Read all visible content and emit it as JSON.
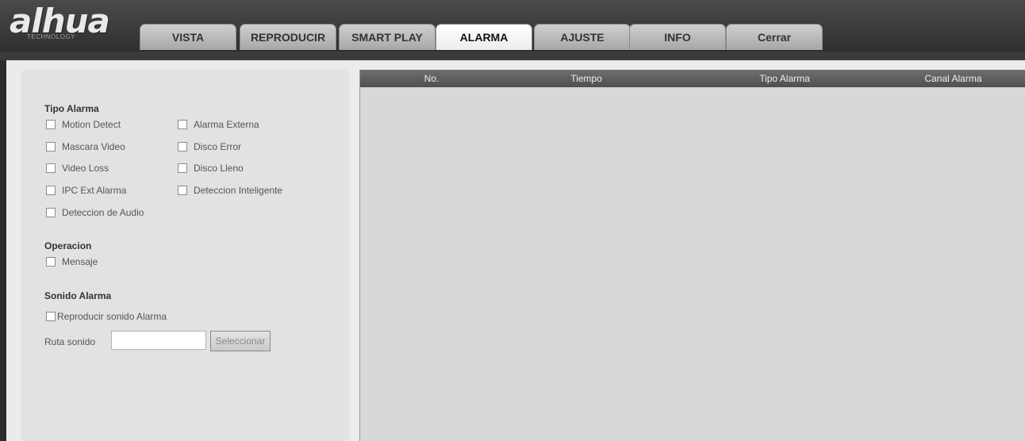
{
  "logo": {
    "main": "alhua",
    "sub": "TECHNOLOGY"
  },
  "tabs": [
    {
      "label": "VISTA",
      "active": false
    },
    {
      "label": "REPRODUCIR",
      "active": false
    },
    {
      "label": "SMART PLAY",
      "active": false
    },
    {
      "label": "ALARMA",
      "active": true
    },
    {
      "label": "AJUSTE",
      "active": false
    },
    {
      "label": "INFO",
      "active": false
    },
    {
      "label": "Cerrar",
      "active": false
    }
  ],
  "alarm_type": {
    "title": "Tipo Alarma",
    "items": [
      {
        "label": "Motion Detect",
        "checked": false
      },
      {
        "label": "Alarma Externa",
        "checked": false
      },
      {
        "label": "Mascara Video",
        "checked": false
      },
      {
        "label": "Disco Error",
        "checked": false
      },
      {
        "label": "Video Loss",
        "checked": false
      },
      {
        "label": "Disco Lleno",
        "checked": false
      },
      {
        "label": "IPC Ext Alarma",
        "checked": false
      },
      {
        "label": "Deteccion Inteligente",
        "checked": false
      },
      {
        "label": "Deteccion de Audio",
        "checked": false
      }
    ]
  },
  "operation": {
    "title": "Operacion",
    "items": [
      {
        "label": "Mensaje",
        "checked": false
      }
    ]
  },
  "sound": {
    "title": "Sonido Alarma",
    "play_label": "Reproducir sonido Alarma",
    "play_checked": false,
    "path_label": "Ruta sonido",
    "path_value": "",
    "select_button": "Seleccionar"
  },
  "table": {
    "columns": [
      "No.",
      "Tiempo",
      "Tipo Alarma",
      "Canal Alarma"
    ],
    "rows": []
  }
}
